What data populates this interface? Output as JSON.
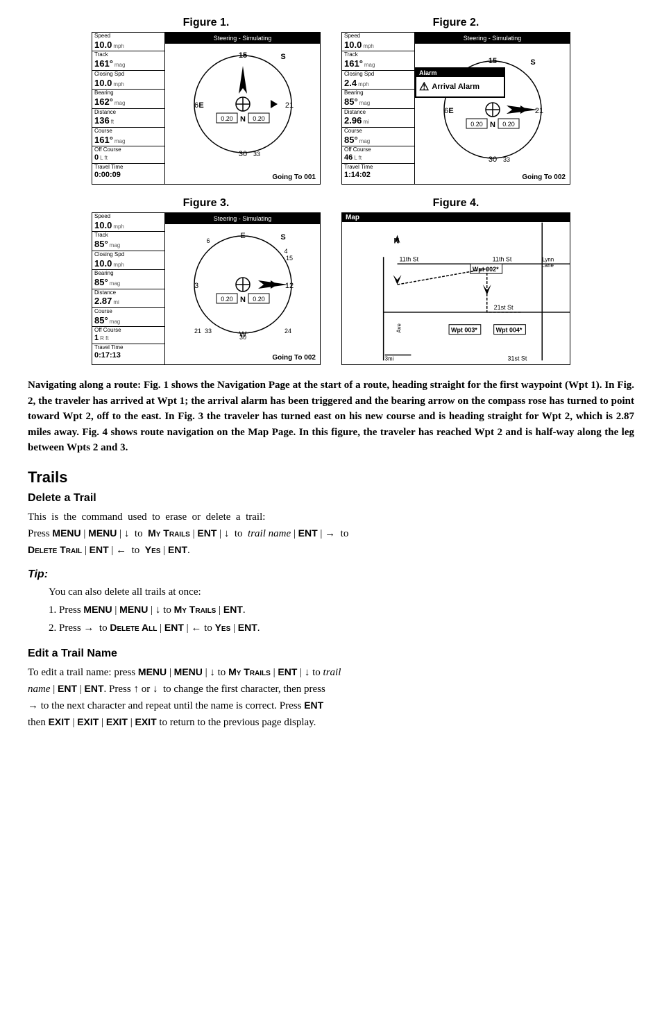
{
  "figures": {
    "row1": [
      {
        "title": "Figure 1.",
        "type": "nav",
        "topbar": "Steering - Simulating",
        "fields": [
          {
            "label": "Speed",
            "value": "10.0",
            "unit": "mph"
          },
          {
            "label": "Track",
            "value": "161°",
            "unit": "mag"
          },
          {
            "label": "Closing Spd",
            "value": "10.0",
            "unit": "mph"
          },
          {
            "label": "Bearing",
            "value": "162°",
            "unit": "mag"
          },
          {
            "label": "Distance",
            "value": "136",
            "unit": "ft"
          },
          {
            "label": "Course",
            "value": "161°",
            "unit": "mag"
          },
          {
            "label": "Off Course",
            "value": "0",
            "unit": "L  ft"
          },
          {
            "label": "Travel Time",
            "value": "0:00:09",
            "unit": ""
          }
        ],
        "going_to": "Going To 001",
        "compass_north": 0,
        "has_alarm": false
      },
      {
        "title": "Figure 2.",
        "type": "nav",
        "topbar": "Steering - Simulating",
        "fields": [
          {
            "label": "Speed",
            "value": "10.0",
            "unit": "mph"
          },
          {
            "label": "Track",
            "value": "161°",
            "unit": "mag"
          },
          {
            "label": "Closing Spd",
            "value": "2.4",
            "unit": "mph"
          },
          {
            "label": "Bearing",
            "value": "85°",
            "unit": "mag"
          },
          {
            "label": "Distance",
            "value": "2.96",
            "unit": "mi"
          },
          {
            "label": "Course",
            "value": "85°",
            "unit": "mag"
          },
          {
            "label": "Off Course",
            "value": "46",
            "unit": "L  ft"
          },
          {
            "label": "Travel Time",
            "value": "1:14:02",
            "unit": ""
          }
        ],
        "going_to": "Going To 002",
        "compass_north": 0,
        "has_alarm": true
      }
    ],
    "row2": [
      {
        "title": "Figure 3.",
        "type": "nav",
        "topbar": "Steering - Simulating",
        "fields": [
          {
            "label": "Speed",
            "value": "10.0",
            "unit": "mph"
          },
          {
            "label": "Track",
            "value": "85°",
            "unit": "mag"
          },
          {
            "label": "Closing Spd",
            "value": "10.0",
            "unit": "mph"
          },
          {
            "label": "Bearing",
            "value": "85°",
            "unit": "mag"
          },
          {
            "label": "Distance",
            "value": "2.87",
            "unit": "mi"
          },
          {
            "label": "Course",
            "value": "85°",
            "unit": "mag"
          },
          {
            "label": "Off Course",
            "value": "1",
            "unit": "R  ft"
          },
          {
            "label": "Travel Time",
            "value": "0:17:13",
            "unit": ""
          }
        ],
        "going_to": "Going To 002",
        "compass_north": 90,
        "has_alarm": false
      },
      {
        "title": "Figure 4.",
        "type": "map",
        "label": "Map"
      }
    ]
  },
  "body_text": "Navigating along a route: Fig. 1 shows the Navigation Page at the start of a route, heading straight for the first waypoint (Wpt 1). In Fig. 2, the traveler has arrived at Wpt 1; the arrival alarm has been triggered and the bearing arrow on the compass rose has turned to point toward Wpt 2, off to the east. In Fig. 3 the traveler has turned east on his new course and is heading straight for Wpt 2, which is 2.87 miles away. Fig. 4 shows route navigation on the Map Page. In this figure, the traveler has reached Wpt 2 and is half-way along the leg between Wpts 2 and 3.",
  "sections": {
    "trails": {
      "title": "Trails",
      "delete_trail": {
        "title": "Delete a Trail",
        "text": "This  is  the  command  used  to  erase  or  delete  a  trail:"
      },
      "tip": {
        "title": "Tip:",
        "intro": "You can also delete all trails at once:"
      },
      "edit_trail": {
        "title": "Edit a Trail Name"
      }
    }
  }
}
